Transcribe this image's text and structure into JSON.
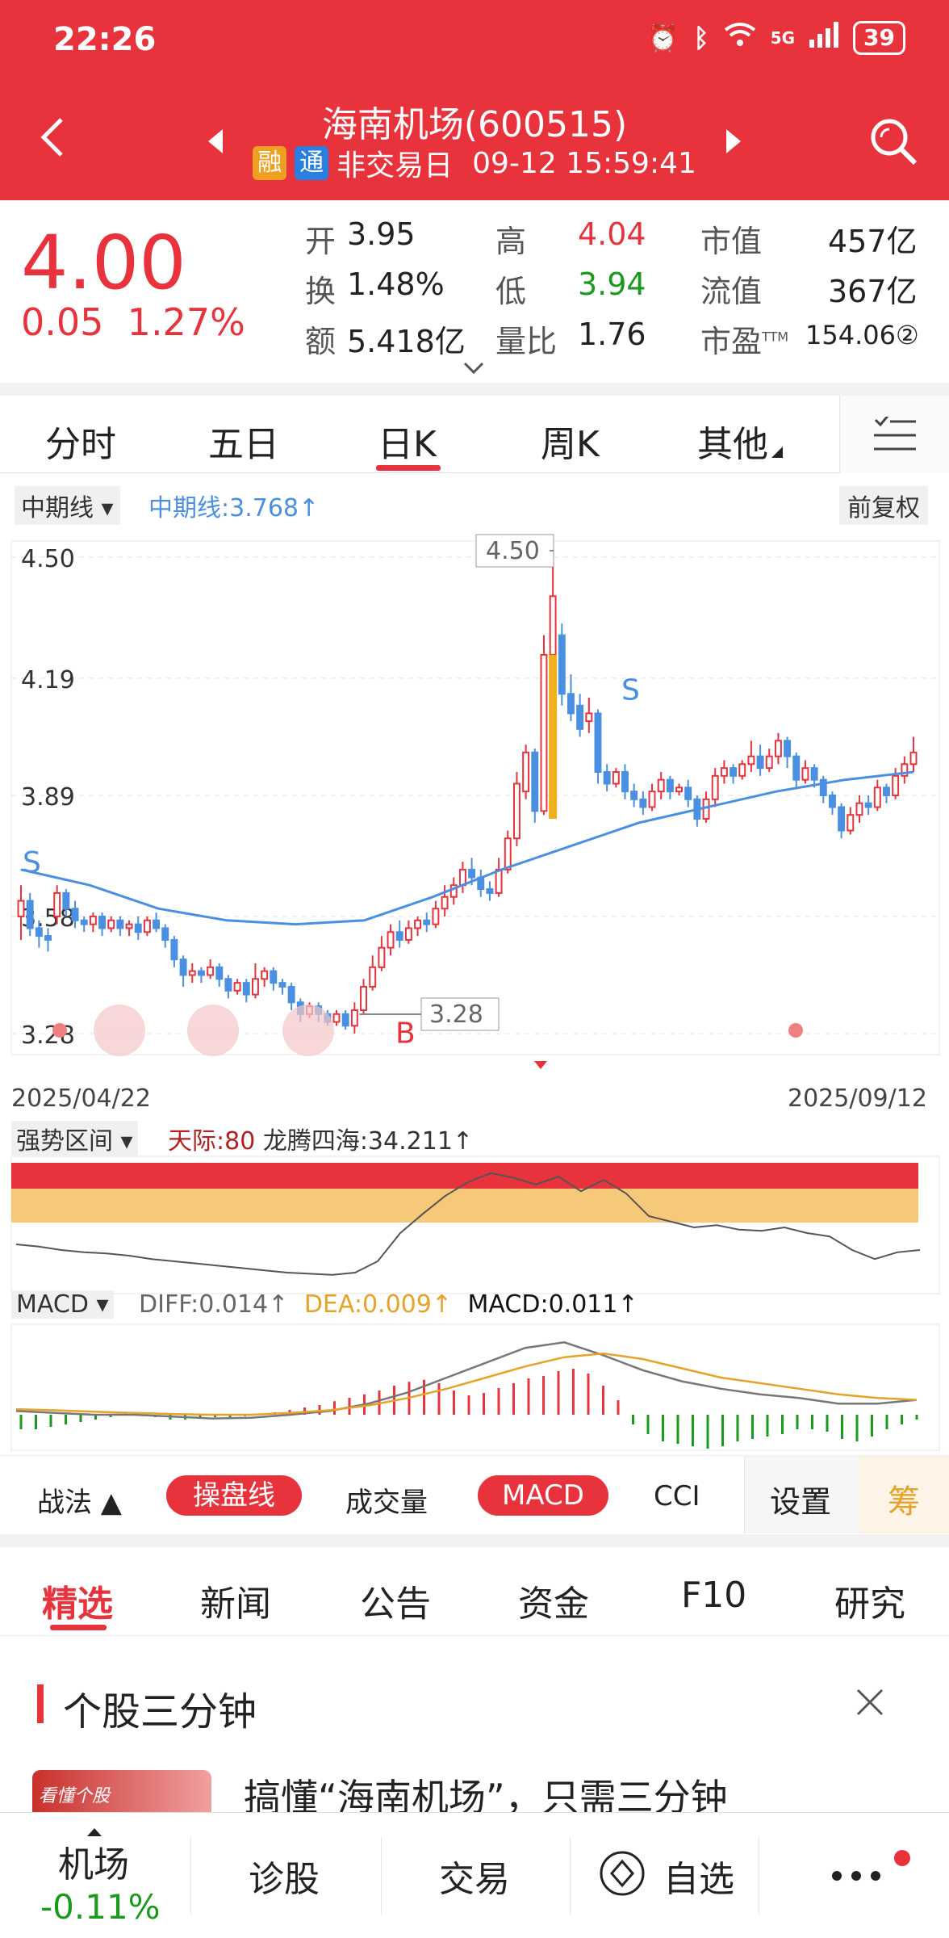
{
  "status": {
    "time": "22:26",
    "battery": "39",
    "network": "5G"
  },
  "header": {
    "title": "海南机场(600515)",
    "tag_margin": "融",
    "tag_connect": "通",
    "trade_status": "非交易日",
    "datetime": "09-12 15:59:41"
  },
  "quote": {
    "price": "4.00",
    "change": "0.05",
    "change_pct": "1.27%",
    "open_label": "开",
    "open": "3.95",
    "high_label": "高",
    "high": "4.04",
    "mktcap_label": "市值",
    "mktcap": "457亿",
    "turnover_label": "换",
    "turnover": "1.48%",
    "low_label": "低",
    "low": "3.94",
    "float_label": "流值",
    "float_cap": "367亿",
    "amount_label": "额",
    "amount": "5.418亿",
    "volratio_label": "量比",
    "volratio": "1.76",
    "pe_label": "市盈",
    "pe_sup": "TTM",
    "pe": "154.06②"
  },
  "period_tabs": [
    "分时",
    "五日",
    "日K",
    "周K",
    "其他"
  ],
  "active_period": "日K",
  "chart_toolbar": {
    "ma_select": "中期线",
    "ma_value": "中期线:3.768↑",
    "adjust": "前复权"
  },
  "chart_data": {
    "type": "candlestick",
    "start_date": "2025/04/22",
    "end_date": "2025/09/12",
    "ylim": [
      3.28,
      4.5
    ],
    "y_ticks": [
      "4.50",
      "4.19",
      "3.89",
      "3.58",
      "3.28"
    ],
    "max_label": "4.50",
    "min_label": "3.28",
    "signals": [
      "S",
      "B",
      "S"
    ],
    "candles": [
      [
        3.58,
        3.62,
        3.52,
        3.66
      ],
      [
        3.62,
        3.55,
        3.53,
        3.64
      ],
      [
        3.55,
        3.53,
        3.5,
        3.57
      ],
      [
        3.53,
        3.52,
        3.49,
        3.55
      ],
      [
        3.58,
        3.64,
        3.56,
        3.66
      ],
      [
        3.64,
        3.6,
        3.58,
        3.65
      ],
      [
        3.6,
        3.57,
        3.55,
        3.62
      ],
      [
        3.57,
        3.56,
        3.54,
        3.58
      ],
      [
        3.56,
        3.58,
        3.54,
        3.59
      ],
      [
        3.58,
        3.55,
        3.53,
        3.59
      ],
      [
        3.55,
        3.57,
        3.54,
        3.58
      ],
      [
        3.57,
        3.55,
        3.53,
        3.58
      ],
      [
        3.55,
        3.56,
        3.53,
        3.57
      ],
      [
        3.56,
        3.54,
        3.52,
        3.58
      ],
      [
        3.54,
        3.57,
        3.53,
        3.58
      ],
      [
        3.57,
        3.55,
        3.54,
        3.59
      ],
      [
        3.55,
        3.52,
        3.5,
        3.56
      ],
      [
        3.52,
        3.47,
        3.45,
        3.53
      ],
      [
        3.47,
        3.43,
        3.4,
        3.48
      ],
      [
        3.43,
        3.44,
        3.41,
        3.46
      ],
      [
        3.44,
        3.43,
        3.41,
        3.45
      ],
      [
        3.43,
        3.45,
        3.42,
        3.47
      ],
      [
        3.45,
        3.42,
        3.4,
        3.46
      ],
      [
        3.42,
        3.39,
        3.37,
        3.43
      ],
      [
        3.39,
        3.41,
        3.38,
        3.42
      ],
      [
        3.41,
        3.38,
        3.36,
        3.42
      ],
      [
        3.38,
        3.42,
        3.37,
        3.46
      ],
      [
        3.42,
        3.44,
        3.4,
        3.45
      ],
      [
        3.44,
        3.41,
        3.39,
        3.45
      ],
      [
        3.41,
        3.4,
        3.38,
        3.42
      ],
      [
        3.4,
        3.36,
        3.34,
        3.41
      ],
      [
        3.36,
        3.33,
        3.31,
        3.37
      ],
      [
        3.33,
        3.35,
        3.32,
        3.36
      ],
      [
        3.35,
        3.33,
        3.31,
        3.36
      ],
      [
        3.33,
        3.31,
        3.3,
        3.34
      ],
      [
        3.31,
        3.33,
        3.3,
        3.34
      ],
      [
        3.33,
        3.3,
        3.29,
        3.34
      ],
      [
        3.3,
        3.34,
        3.28,
        3.36
      ],
      [
        3.34,
        3.4,
        3.33,
        3.42
      ],
      [
        3.4,
        3.45,
        3.39,
        3.48
      ],
      [
        3.45,
        3.5,
        3.44,
        3.53
      ],
      [
        3.5,
        3.54,
        3.48,
        3.56
      ],
      [
        3.54,
        3.52,
        3.5,
        3.57
      ],
      [
        3.52,
        3.55,
        3.51,
        3.57
      ],
      [
        3.55,
        3.57,
        3.53,
        3.58
      ],
      [
        3.57,
        3.56,
        3.54,
        3.59
      ],
      [
        3.56,
        3.6,
        3.55,
        3.62
      ],
      [
        3.6,
        3.63,
        3.58,
        3.66
      ],
      [
        3.63,
        3.66,
        3.61,
        3.68
      ],
      [
        3.66,
        3.7,
        3.64,
        3.72
      ],
      [
        3.7,
        3.68,
        3.66,
        3.73
      ],
      [
        3.68,
        3.65,
        3.63,
        3.7
      ],
      [
        3.65,
        3.64,
        3.62,
        3.67
      ],
      [
        3.64,
        3.7,
        3.63,
        3.73
      ],
      [
        3.7,
        3.78,
        3.69,
        3.8
      ],
      [
        3.78,
        3.92,
        3.76,
        3.95
      ],
      [
        3.9,
        4.0,
        3.88,
        4.02
      ],
      [
        4.0,
        3.85,
        3.82,
        4.01
      ],
      [
        3.85,
        4.25,
        3.84,
        4.3
      ],
      [
        4.25,
        4.4,
        4.22,
        4.5
      ],
      [
        4.3,
        4.15,
        4.12,
        4.33
      ],
      [
        4.15,
        4.1,
        4.08,
        4.2
      ],
      [
        4.12,
        4.06,
        4.04,
        4.15
      ],
      [
        4.08,
        4.1,
        4.05,
        4.14
      ],
      [
        4.1,
        3.95,
        3.92,
        4.11
      ],
      [
        3.95,
        3.92,
        3.9,
        3.97
      ],
      [
        3.92,
        3.95,
        3.91,
        3.96
      ],
      [
        3.95,
        3.9,
        3.88,
        3.97
      ],
      [
        3.9,
        3.88,
        3.86,
        3.92
      ],
      [
        3.88,
        3.86,
        3.84,
        3.9
      ],
      [
        3.86,
        3.9,
        3.85,
        3.92
      ],
      [
        3.9,
        3.93,
        3.88,
        3.95
      ],
      [
        3.93,
        3.9,
        3.88,
        3.94
      ],
      [
        3.9,
        3.91,
        3.89,
        3.92
      ],
      [
        3.91,
        3.88,
        3.86,
        3.93
      ],
      [
        3.88,
        3.83,
        3.81,
        3.89
      ],
      [
        3.83,
        3.88,
        3.82,
        3.9
      ],
      [
        3.88,
        3.94,
        3.86,
        3.96
      ],
      [
        3.94,
        3.96,
        3.92,
        3.98
      ],
      [
        3.96,
        3.94,
        3.92,
        3.97
      ],
      [
        3.94,
        3.97,
        3.93,
        3.98
      ],
      [
        3.97,
        3.99,
        3.95,
        4.03
      ],
      [
        3.99,
        3.96,
        3.94,
        4.02
      ],
      [
        3.96,
        3.99,
        3.95,
        4.01
      ],
      [
        3.99,
        4.03,
        3.97,
        4.05
      ],
      [
        4.03,
        3.99,
        3.96,
        4.04
      ],
      [
        3.99,
        3.93,
        3.91,
        4.0
      ],
      [
        3.93,
        3.96,
        3.92,
        3.98
      ],
      [
        3.96,
        3.93,
        3.91,
        3.97
      ],
      [
        3.93,
        3.89,
        3.87,
        3.94
      ],
      [
        3.89,
        3.86,
        3.84,
        3.9
      ],
      [
        3.86,
        3.8,
        3.78,
        3.87
      ],
      [
        3.8,
        3.84,
        3.79,
        3.86
      ],
      [
        3.84,
        3.87,
        3.82,
        3.89
      ],
      [
        3.87,
        3.86,
        3.84,
        3.89
      ],
      [
        3.86,
        3.91,
        3.85,
        3.93
      ],
      [
        3.91,
        3.89,
        3.87,
        3.92
      ],
      [
        3.89,
        3.94,
        3.88,
        3.96
      ],
      [
        3.94,
        3.97,
        3.92,
        3.99
      ],
      [
        3.97,
        4.0,
        3.95,
        4.04
      ]
    ],
    "ma": [
      3.7,
      3.66,
      3.6,
      3.57,
      3.56,
      3.57,
      3.63,
      3.7,
      3.76,
      3.82,
      3.86,
      3.9,
      3.93,
      3.95
    ]
  },
  "strength": {
    "label": "强势区间",
    "tianji": "天际:80",
    "longteng": "龙腾四海:34.211↑"
  },
  "macd": {
    "label": "MACD",
    "diff": "DIFF:0.014↑",
    "dea": "DEA:0.009↑",
    "macd": "MACD:0.011↑"
  },
  "indicator_bar": {
    "zhanfa": "战法 ▲",
    "caopanxian": "操盘线",
    "volume": "成交量",
    "macd": "MACD",
    "cci": "CCI",
    "settings": "设置",
    "chou": "筹"
  },
  "news_tabs": [
    "精选",
    "新闻",
    "公告",
    "资金",
    "F10",
    "研究"
  ],
  "active_news": "精选",
  "section": {
    "title": "个股三分钟",
    "article": "搞懂“海南机场”，只需三分钟",
    "thumb_text": "看懂个股"
  },
  "bottom_nav": {
    "sector": "机场",
    "sector_change": "-0.11%",
    "diagnose": "诊股",
    "trade": "交易",
    "watchlist": "自选"
  },
  "colors": {
    "red": "#e8333c",
    "green": "#1a9a1a",
    "blue": "#4a90e2",
    "orange": "#e8a228"
  }
}
